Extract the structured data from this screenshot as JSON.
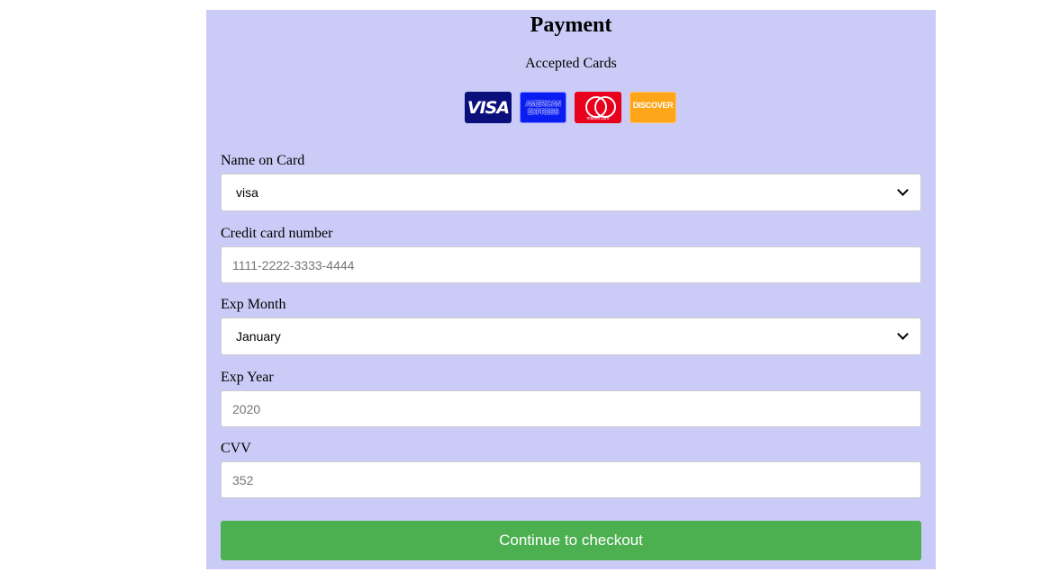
{
  "form": {
    "title": "Payment",
    "accepted_label": "Accepted Cards",
    "cards": [
      "VISA",
      "AMERICAN EXPRESS",
      "mastercard",
      "DISCOVER"
    ],
    "fields": {
      "name": {
        "label": "Name on Card",
        "value": "visa"
      },
      "number": {
        "label": "Credit card number",
        "placeholder": "1111-2222-3333-4444"
      },
      "exp_month": {
        "label": "Exp Month",
        "value": "January"
      },
      "exp_year": {
        "label": "Exp Year",
        "placeholder": "2020"
      },
      "cvv": {
        "label": "CVV",
        "placeholder": "352"
      }
    },
    "submit_label": "Continue to checkout"
  },
  "colors": {
    "panel_bg": "#cacbf6",
    "button_bg": "#4caf50",
    "visa": "#0b0f7c",
    "amex": "#0a1df0",
    "mastercard": "#e8001c",
    "discover": "#ffa51a"
  },
  "icons": [
    "visa-card-icon",
    "amex-card-icon",
    "mastercard-card-icon",
    "discover-card-icon",
    "chevron-down-icon"
  ]
}
